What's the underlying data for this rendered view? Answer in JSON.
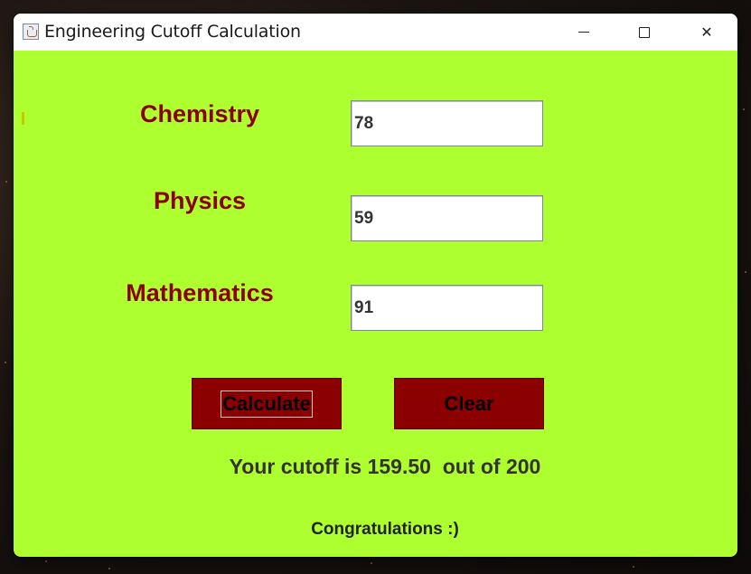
{
  "window": {
    "title": "Engineering Cutoff Calculation",
    "icon": "java-cup-icon"
  },
  "colors": {
    "background": "#adff2f",
    "label": "#8b0000",
    "button": "#8b0000"
  },
  "form": {
    "chemistry": {
      "label": "Chemistry",
      "value": "78"
    },
    "physics": {
      "label": "Physics",
      "value": "59"
    },
    "mathematics": {
      "label": "Mathematics",
      "value": "91"
    }
  },
  "buttons": {
    "calculate": "Calculate",
    "clear": "Clear"
  },
  "result": {
    "text": "Your cutoff is 159.50  out of 200",
    "message": "Congratulations :)"
  }
}
